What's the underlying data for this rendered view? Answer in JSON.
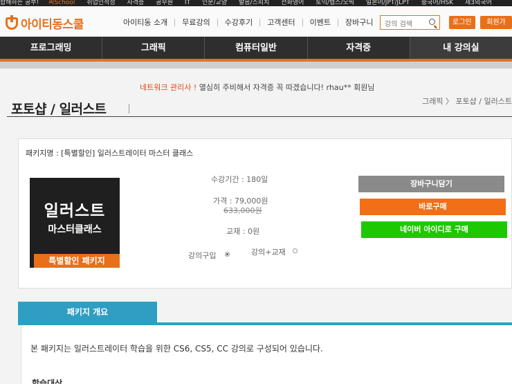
{
  "topstrip": {
    "items": [
      "합해하는 공부!",
      "취업인적성",
      "자격증",
      "공무원",
      "IT",
      "인문/교양",
      "발음/스피치",
      "전화영어",
      "토익/텝스/오픽",
      "일본어/JPT/JLPT",
      "중국어/HSK",
      "제3외국어"
    ],
    "highlight": "씨School"
  },
  "header": {
    "logo_text": "아이티동스쿨",
    "nav": [
      "아이티동 소개",
      "무료강의",
      "수강후기",
      "고객센터",
      "이벤트",
      "장바구니"
    ],
    "search_placeholder": "강의 검색",
    "login_label": "로그인",
    "join_label": "회원가입"
  },
  "catnav": [
    "프로그래밍",
    "그래픽",
    "컴퓨터일반",
    "자격증",
    "내 강의실"
  ],
  "notice": {
    "highlight": "네트워크 관리사 !",
    "text": " 열심히 주비해서 자격증 꼭 따겠습니다! rhau** 회원님"
  },
  "page": {
    "title": "포토샵 / 일러스트",
    "breadcrumb": "그래픽 〉 포토샵 / 일러스트"
  },
  "package": {
    "name": "패키지명 : [특별할인] 일러스트레이터 마스터 클래스",
    "thumb_title": "일러스트",
    "thumb_sub": "마스터클래스",
    "thumb_badge": "특별할인 패키지",
    "period": "수강기간 : 180일",
    "price": "가격 : 79,000원",
    "original_price": "633,000원",
    "textbook": "교재 : 0원",
    "option_lecture": "강의구입",
    "option_lecture_book": "강의+교재",
    "btn_cart": "장바구니담기",
    "btn_buy": "바로구매",
    "btn_naver": "네이버 아이디로 구매"
  },
  "tabs": {
    "overview": "패키지 개요",
    "description": "본 패키지는 일러스트레이터 학습을 위한 CS6, CS5, CC 강의로 구성되어 있습니다.",
    "target": "학습대상"
  },
  "colors": {
    "brand_orange": "#e8701a",
    "tab_blue": "#2f9ec2",
    "naver_green": "#1ec800"
  }
}
